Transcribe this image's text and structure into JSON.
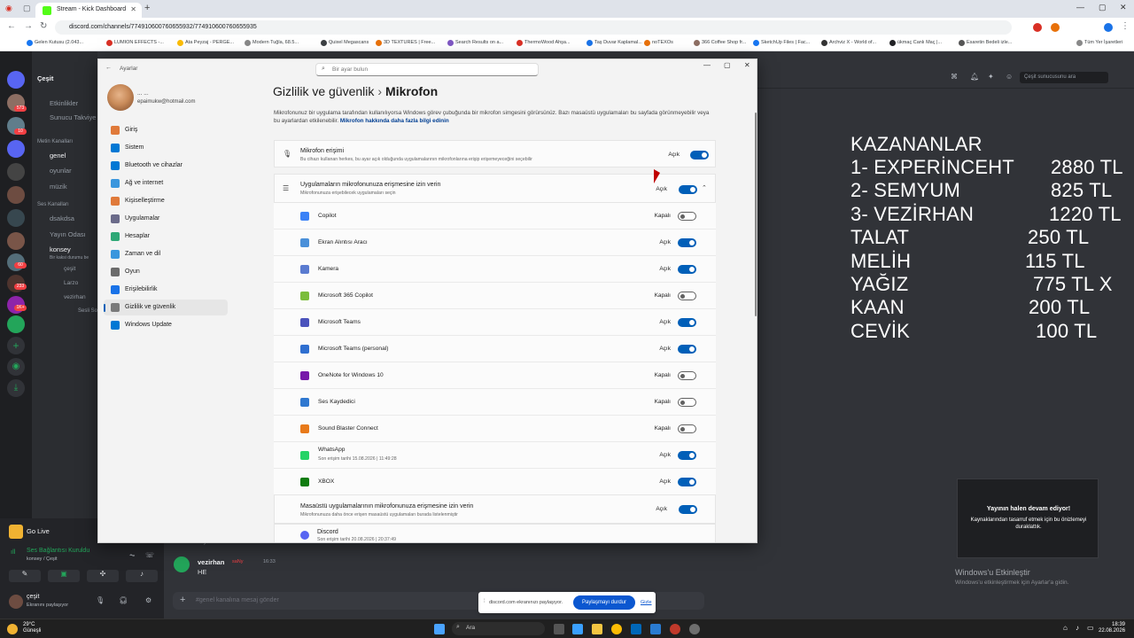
{
  "browser": {
    "tab_title": "Stream - Kick Dashboard",
    "url": "discord.com/channels/774910600760655932/774910600760655935",
    "bookmarks": [
      "Gelen Kutusu (2.043...",
      "LUMION EFFECTS -...",
      "Ata Peyzaj - PERGE...",
      "Modern Tuğla, 68.5...",
      "Quixel Megascans",
      "3D TEXTURES | Free...",
      "Search Results on a...",
      "ThermoWood Ahşa...",
      "Taş Duvar Kaplamal...",
      "noTEXOs",
      "366 Coffee Shop fr...",
      "SketchUp Files | Fac...",
      "Archviz X - World of...",
      "ükmaç Canlı Maç |...",
      "Esaretin Bedeli izle...",
      "Tüm Yer İşaretleri"
    ],
    "bookmark_colors": [
      "#1877f2",
      "#d93025",
      "#fbbc04",
      "#888888",
      "#3c4043",
      "#e8710a",
      "#7e57c2",
      "#d93025",
      "#1a73e8",
      "#e8710a",
      "#8d6e63",
      "#1877f2",
      "#333333",
      "#202124",
      "#555555"
    ]
  },
  "discord": {
    "server_name": "Çeşit",
    "channels": {
      "events": "Etkinlikler",
      "server_guide": "Sunucu Takviye",
      "text_header": "Metin Kanalları",
      "genel": "genel",
      "oyunlar": "oyunlar",
      "muzik": "müzik",
      "voice_header": "Ses Kanalları",
      "dsakdsa": "dsakdsa",
      "yayin_odasi": "Yayın Odası",
      "konsey": "konsey",
      "konsey_sub": "Bir kaksi durumu be",
      "users": [
        "çeşit",
        "Larzo",
        "vezirhan",
        "Sesli Sohbe"
      ]
    },
    "server_badges": [
      "573",
      "10",
      "60",
      "233",
      "1K+"
    ],
    "search_placeholder": "Çeşit sunucusunu ara",
    "voice_panel": {
      "go_live": "Go Live",
      "connected": "Ses Bağlantısı Kuruldu",
      "connected_sub": "konsey / Çeşit",
      "user": "çeşit",
      "user_status": "Ekranını paylaşıyor"
    },
    "message": {
      "above": "beyler",
      "author": "vezirhan",
      "author_tag": "saNy",
      "time": "16:33",
      "text": "HE"
    },
    "input_placeholder": "#genel kanalına mesaj gönder",
    "share_bar": {
      "text": "discord.com ekranınızı paylaşıyor.",
      "stop": "Paylaşmayı durdur",
      "hide": "Gizle"
    },
    "preview": {
      "title": "Yayının halen devam ediyor!",
      "body": "Kaynaklarından tasarruf etmek için bu önizlemeyi duraklattık."
    },
    "activation": {
      "title": "Windows'u Etkinleştir",
      "body": "Windows'u etkinleştirmek için Ayarlar'a gidin."
    }
  },
  "winners": {
    "title": "KAZANANLAR",
    "rows": [
      {
        "name": "1- EXPERİNCEHT",
        "amount": "2880 TL"
      },
      {
        "name": "2- SEMYUM",
        "amount": "825 TL"
      },
      {
        "name": "3- VEZİRHAN",
        "amount": "1220 TL"
      },
      {
        "name": "TALAT",
        "amount": "250 TL"
      },
      {
        "name": "MELİH",
        "amount": "115 TL"
      },
      {
        "name": "YAĞIZ",
        "amount": "775 TL  X"
      },
      {
        "name": "KAAN",
        "amount": "200 TL"
      },
      {
        "name": "CEVİK",
        "amount": "100 TL"
      }
    ]
  },
  "settings": {
    "window_title": "Ayarlar",
    "search_placeholder": "Bir ayar bulun",
    "account_name": "... ...",
    "account_email": "epaimukw@hotmail.com",
    "nav": [
      {
        "label": "Giriş",
        "icon": "home-icon",
        "color": "#e07a3a"
      },
      {
        "label": "Sistem",
        "icon": "system-icon",
        "color": "#0078d4"
      },
      {
        "label": "Bluetooth ve cihazlar",
        "icon": "bluetooth-icon",
        "color": "#0078d4"
      },
      {
        "label": "Ağ ve internet",
        "icon": "network-icon",
        "color": "#3a96dd"
      },
      {
        "label": "Kişiselleştirme",
        "icon": "brush-icon",
        "color": "#e07a3a"
      },
      {
        "label": "Uygulamalar",
        "icon": "apps-icon",
        "color": "#6b6b8a"
      },
      {
        "label": "Hesaplar",
        "icon": "accounts-icon",
        "color": "#2ea876"
      },
      {
        "label": "Zaman ve dil",
        "icon": "time-language-icon",
        "color": "#3a96dd"
      },
      {
        "label": "Oyun",
        "icon": "gaming-icon",
        "color": "#6b6b6b"
      },
      {
        "label": "Erişilebilirlik",
        "icon": "accessibility-icon",
        "color": "#1a73e8"
      },
      {
        "label": "Gizlilik ve güvenlik",
        "icon": "shield-icon",
        "color": "#7a7a7a"
      },
      {
        "label": "Windows Update",
        "icon": "update-icon",
        "color": "#0078d4"
      }
    ],
    "breadcrumb_parent": "Gizlilik ve güvenlik",
    "breadcrumb_sep": "›",
    "breadcrumb_current": "Mikrofon",
    "description": "Mikrofonunuz bir uygulama tarafından kullanılıyorsa Windows görev çubuğunda bir mikrofon simgesini görürsünüz. Bazı masaüstü uygulamaları bu sayfada görünmeyebilir veya bu ayarlardan etkilenebilir.",
    "description_link": "Mikrofon hakkında daha fazla bilgi edinin",
    "mic_access": {
      "title": "Mikrofon erişimi",
      "sub": "Bu cihazı kullanan herkes, bu ayar açık olduğunda uygulamalarının mikrofonlarına erişip erişemeyeceğini seçebilir",
      "state": "Açık"
    },
    "app_access": {
      "title": "Uygulamaların mikrofonunuza erişmesine izin verin",
      "sub": "Mikrofonunuza erişebilecek uygulamaları seçin",
      "state": "Açık"
    },
    "apps": [
      {
        "name": "Copilot",
        "sub": "",
        "state": "Kapalı",
        "on": false,
        "color": "#3b82f6"
      },
      {
        "name": "Ekran Alıntısı Aracı",
        "sub": "",
        "state": "Açık",
        "on": true,
        "color": "#4a90d9"
      },
      {
        "name": "Kamera",
        "sub": "",
        "state": "Açık",
        "on": true,
        "color": "#5a7bd0"
      },
      {
        "name": "Microsoft 365 Copilot",
        "sub": "",
        "state": "Kapalı",
        "on": false,
        "color": "#7bbd3b"
      },
      {
        "name": "Microsoft Teams",
        "sub": "",
        "state": "Açık",
        "on": true,
        "color": "#4b53bc"
      },
      {
        "name": "Microsoft Teams (personal)",
        "sub": "",
        "state": "Açık",
        "on": true,
        "color": "#2f6fd0"
      },
      {
        "name": "OneNote for Windows 10",
        "sub": "",
        "state": "Kapalı",
        "on": false,
        "color": "#7719aa"
      },
      {
        "name": "Ses Kaydedici",
        "sub": "",
        "state": "Kapalı",
        "on": false,
        "color": "#2f78d0"
      },
      {
        "name": "Sound Blaster Connect",
        "sub": "",
        "state": "Kapalı",
        "on": false,
        "color": "#e87a1a"
      },
      {
        "name": "WhatsApp",
        "sub": "Son erişim tarihi 15.08.2026  |  11:49:28",
        "state": "Açık",
        "on": true,
        "color": "#25d366"
      },
      {
        "name": "XBOX",
        "sub": "",
        "state": "Açık",
        "on": true,
        "color": "#107c10"
      }
    ],
    "desktop_access": {
      "title": "Masaüstü uygulamalarının mikrofonunuza erişmesine izin verin",
      "sub": "Mikrofonunuza daha önce erişen masaüstü uygulamaları burada listelenmiştir",
      "state": "Açık"
    },
    "discord_entry": {
      "name": "Discord",
      "sub": "Son erişim tarihi 20.08.2026  |  20:37:49"
    }
  },
  "taskbar": {
    "weather_temp": "29°C",
    "weather_desc": "Güneşli",
    "search": "Ara",
    "time": "18:39",
    "date": "22.08.2026"
  }
}
